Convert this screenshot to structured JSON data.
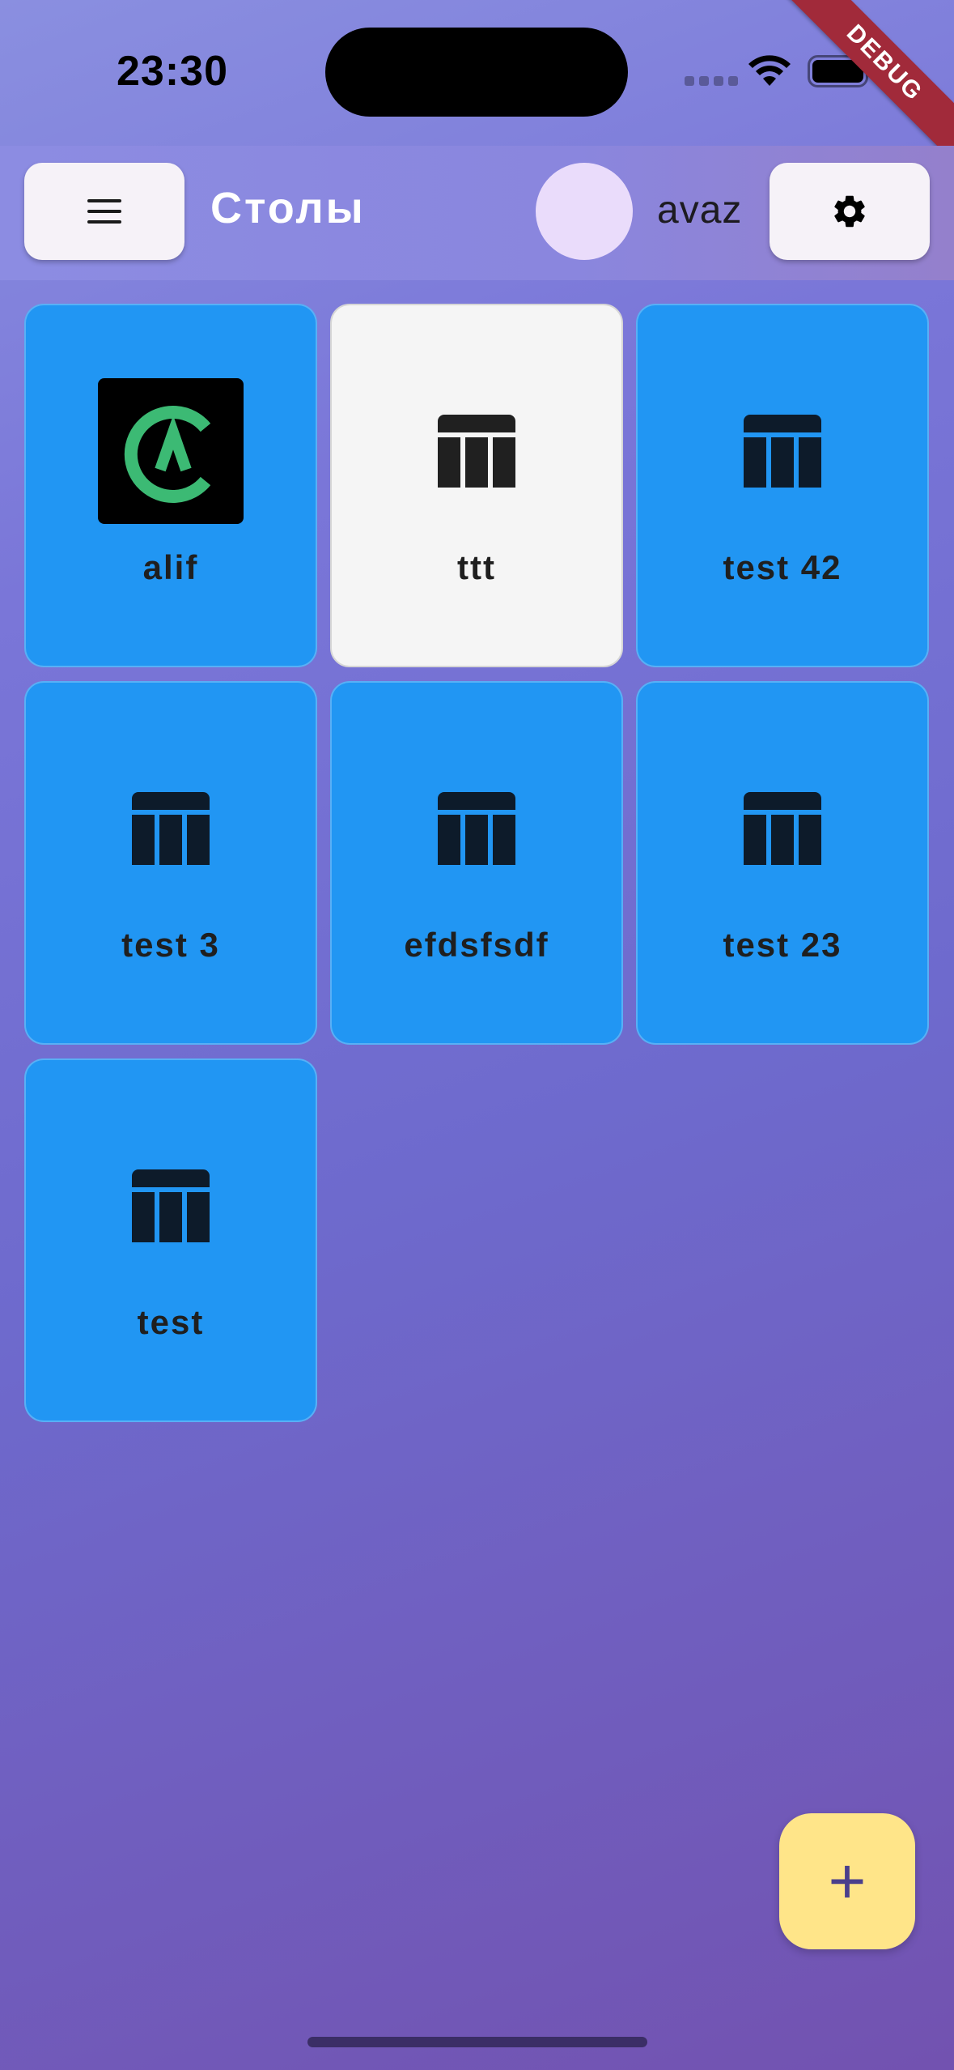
{
  "status_bar": {
    "time": "23:30"
  },
  "debug_banner": "DEBUG",
  "app_bar": {
    "title": "Столы",
    "username": "avaz",
    "menu_icon": "menu-icon",
    "settings_icon": "gear-icon"
  },
  "tables": [
    {
      "label": "alif",
      "icon": "alif-logo",
      "style": "blue"
    },
    {
      "label": "ttt",
      "icon": "table-icon",
      "style": "light"
    },
    {
      "label": "test 42",
      "icon": "table-icon",
      "style": "blue"
    },
    {
      "label": "test 3",
      "icon": "table-icon",
      "style": "blue"
    },
    {
      "label": "efdsfsdf",
      "icon": "table-icon",
      "style": "blue"
    },
    {
      "label": "test 23",
      "icon": "table-icon",
      "style": "blue"
    },
    {
      "label": "test",
      "icon": "table-icon",
      "style": "blue"
    }
  ],
  "fab": {
    "label": "+",
    "icon": "plus-icon"
  },
  "colors": {
    "card_blue": "#2196f3",
    "card_light": "#f5f5f5",
    "fab": "#ffe589",
    "debug": "#a12a3a"
  }
}
